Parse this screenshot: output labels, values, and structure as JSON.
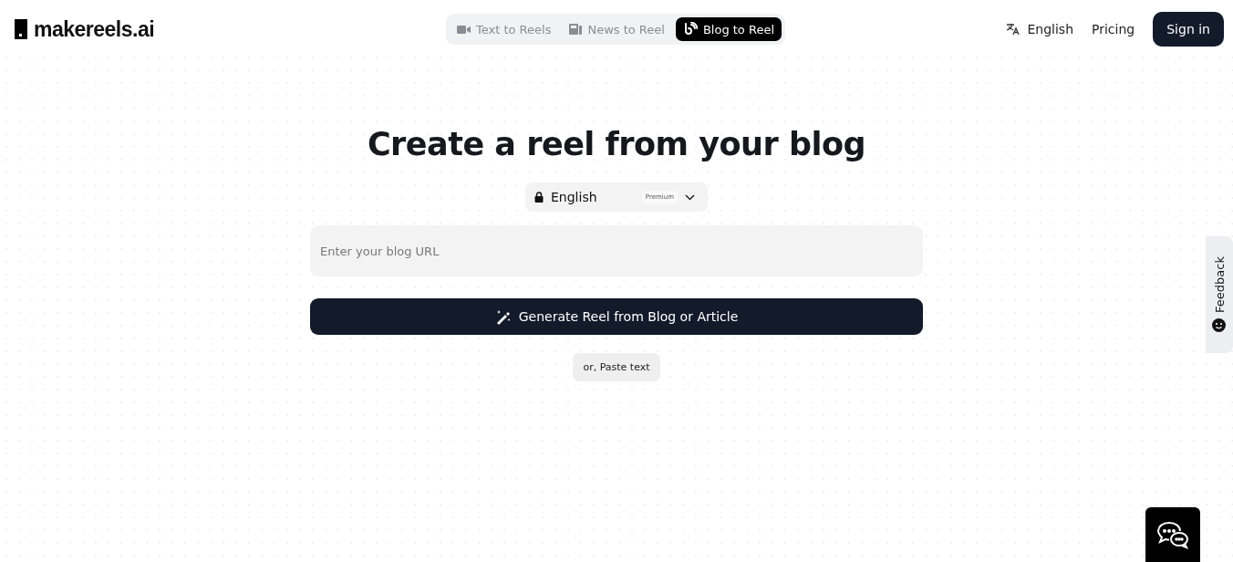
{
  "header": {
    "logo": "makereels.ai",
    "tabs": [
      {
        "label": "Text to Reels",
        "kind": "video",
        "selected": false
      },
      {
        "label": "News to Reel",
        "kind": "news",
        "selected": false
      },
      {
        "label": "Blog to Reel",
        "kind": "blog",
        "selected": true
      }
    ],
    "language": "English",
    "pricing": "Pricing",
    "sign_in": "Sign in"
  },
  "main": {
    "title": "Create a reel from your blog",
    "language_select": {
      "value": "English",
      "badge": "Premium",
      "locked": true
    },
    "url_field": {
      "placeholder": "Enter your blog URL"
    },
    "generate_button": "Generate Reel from Blog or Article",
    "paste_button": "or, Paste text"
  },
  "feedback": "Feedback"
}
